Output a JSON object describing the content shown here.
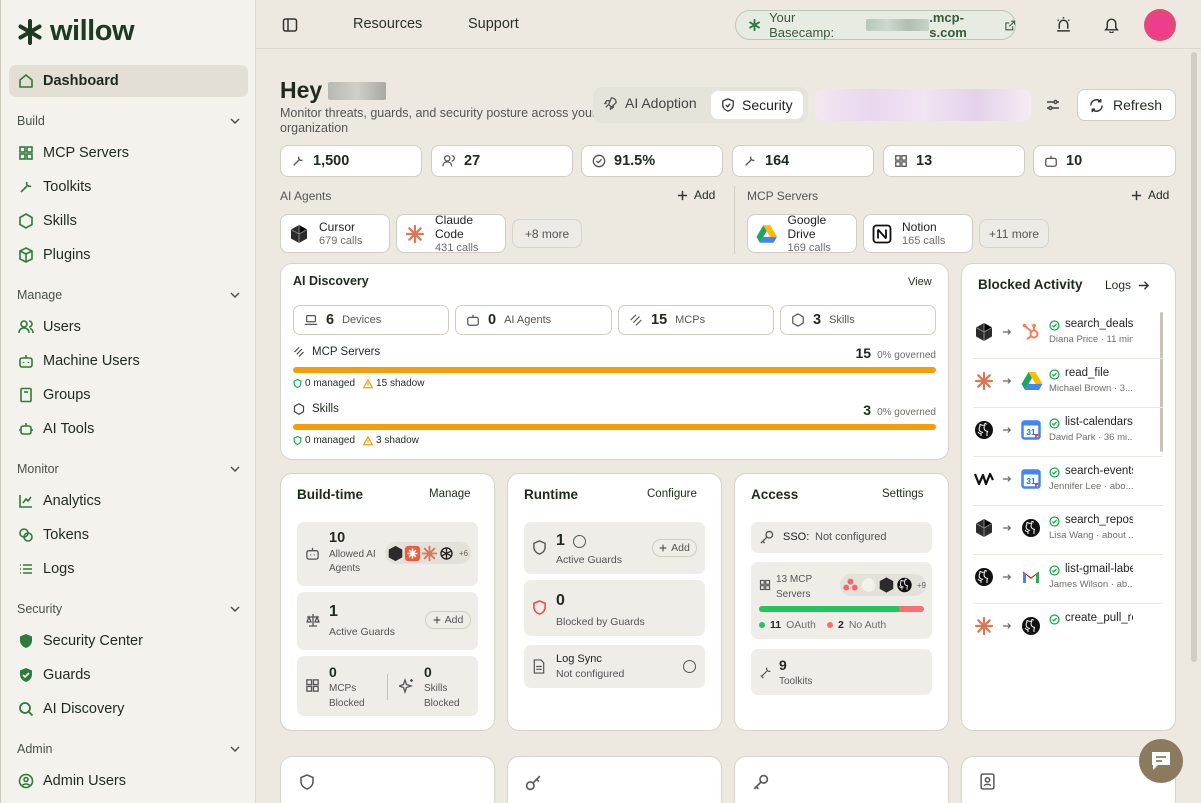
{
  "app": {
    "name": "willow"
  },
  "sidebar": {
    "dashboard": "Dashboard",
    "sections": {
      "build": "Build",
      "manage": "Manage",
      "monitor": "Monitor",
      "security": "Security",
      "admin": "Admin"
    },
    "items": {
      "mcp_servers": "MCP Servers",
      "toolkits": "Toolkits",
      "skills": "Skills",
      "plugins": "Plugins",
      "users": "Users",
      "machine_users": "Machine Users",
      "groups": "Groups",
      "ai_tools": "AI Tools",
      "analytics": "Analytics",
      "tokens": "Tokens",
      "logs": "Logs",
      "security_center": "Security Center",
      "guards": "Guards",
      "ai_discovery": "AI Discovery",
      "admin_users": "Admin Users"
    }
  },
  "topbar": {
    "resources": "Resources",
    "support": "Support",
    "basecamp_label": "Your Basecamp:",
    "basecamp_domain": ".mcp-s.com"
  },
  "header": {
    "greeting": "Hey",
    "subtitle": "Monitor threats, guards, and security posture across your organization",
    "tab_ai_adoption": "AI Adoption",
    "tab_security": "Security",
    "refresh": "Refresh"
  },
  "stats": [
    "1,500",
    "27",
    "91.5%",
    "164",
    "13",
    "10"
  ],
  "agents": {
    "title": "AI Agents",
    "add": "Add",
    "items": [
      {
        "name": "Cursor",
        "calls": "679 calls"
      },
      {
        "name": "Claude Code",
        "calls": "431 calls"
      }
    ],
    "more": "+8 more"
  },
  "mcp": {
    "title": "MCP Servers",
    "add": "Add",
    "items": [
      {
        "name": "Google Drive",
        "calls": "169 calls"
      },
      {
        "name": "Notion",
        "calls": "165 calls"
      }
    ],
    "more": "+11 more"
  },
  "discovery": {
    "title": "AI Discovery",
    "view": "View",
    "pills": [
      {
        "n": "6",
        "label": "Devices"
      },
      {
        "n": "0",
        "label": "AI Agents"
      },
      {
        "n": "15",
        "label": "MCPs"
      },
      {
        "n": "3",
        "label": "Skills"
      }
    ],
    "mcp_label": "MCP Servers",
    "mcp_count": "15",
    "mcp_governed": "0% governed",
    "mcp_managed": "0 managed",
    "mcp_shadow": "15 shadow",
    "skills_label": "Skills",
    "skills_count": "3",
    "skills_governed": "0% governed",
    "skills_managed": "0 managed",
    "skills_shadow": "3 shadow",
    "mcp_shadow_fraction": 1.0,
    "skills_shadow_fraction": 1.0
  },
  "buildtime": {
    "title": "Build-time",
    "action": "Manage",
    "allowed_n": "10",
    "allowed_label": "Allowed AI Agents",
    "allowed_more": "+6",
    "guards_n": "1",
    "guards_label": "Active Guards",
    "guards_add": "Add",
    "mcps_n": "0",
    "mcps_label": "MCPs Blocked",
    "skills_n": "0",
    "skills_label": "Skills Blocked"
  },
  "runtime": {
    "title": "Runtime",
    "action": "Configure",
    "guards_n": "1",
    "guards_label": "Active Guards",
    "guards_add": "Add",
    "blocked_n": "0",
    "blocked_label": "Blocked by Guards",
    "logsync_label": "Log Sync",
    "logsync_status": "Not configured"
  },
  "access": {
    "title": "Access",
    "action": "Settings",
    "sso_label": "SSO:",
    "sso_status": "Not configured",
    "mcp_servers_label": "13 MCP Servers",
    "mcp_more": "+9",
    "oauth_n": "11",
    "oauth_label": "OAuth",
    "noauth_n": "2",
    "noauth_label": "No Auth",
    "oauth_fraction": 0.846,
    "toolkits_n": "9",
    "toolkits_label": "Toolkits"
  },
  "blocked": {
    "title": "Blocked Activity",
    "logs": "Logs",
    "items": [
      {
        "action": "search_deals",
        "sub": "Diana Price · 11 min..."
      },
      {
        "action": "read_file",
        "sub": "Michael Brown · 3..."
      },
      {
        "action": "list-calendars",
        "sub": "David Park · 36 mi..."
      },
      {
        "action": "search-events",
        "sub": "Jennifer Lee · abo..."
      },
      {
        "action": "search_repos",
        "sub": "Lisa Wang · about ..."
      },
      {
        "action": "list-gmail-labels",
        "sub": "James Wilson · ab..."
      },
      {
        "action": "create_pull_request",
        "sub": ""
      }
    ]
  },
  "colors": {
    "brand": "#1d3a24",
    "accent": "#2f7a3d",
    "warning": "#f59e0b",
    "danger": "#ef4444",
    "oauth": "#22c55e"
  }
}
